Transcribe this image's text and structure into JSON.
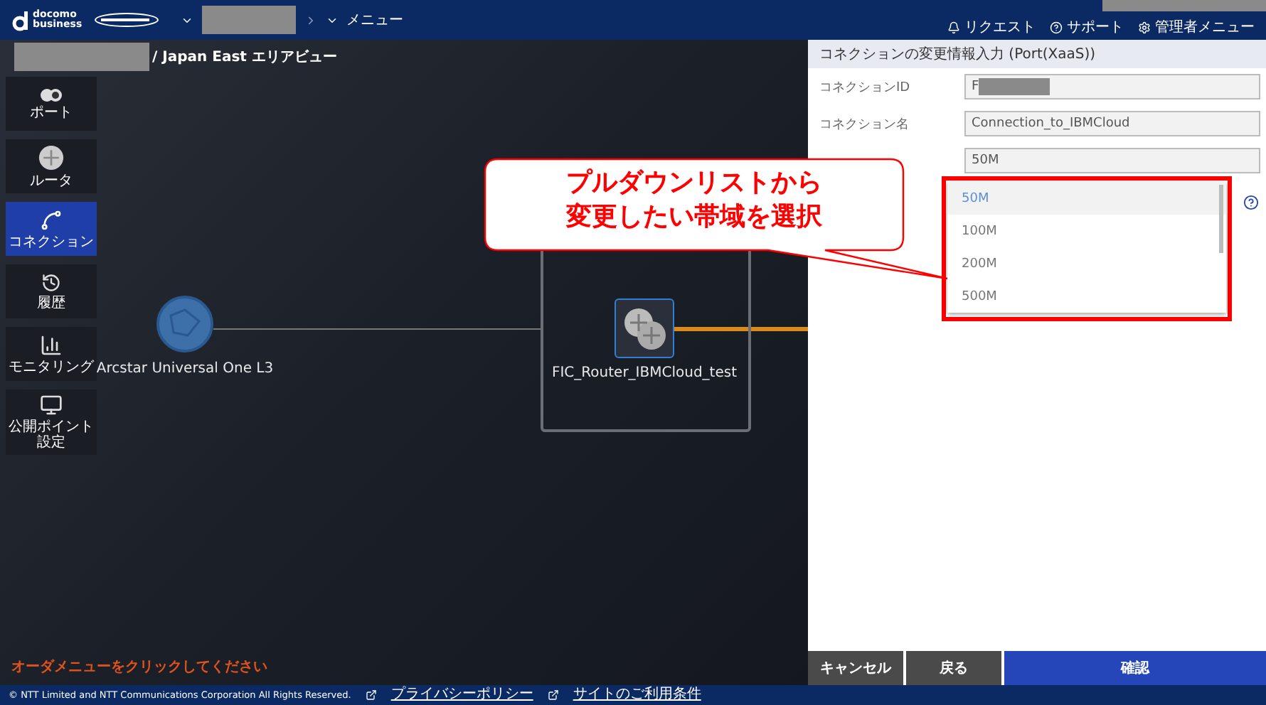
{
  "header": {
    "brand": [
      "docomo",
      "business"
    ],
    "account_redacted": true,
    "breadcrumb": [
      {
        "kind": "redacted"
      },
      {
        "kind": "text",
        "label": "メニュー"
      }
    ],
    "links": [
      {
        "label": "リクエスト"
      },
      {
        "label": "サポート"
      },
      {
        "label": "管理者メニュー"
      }
    ]
  },
  "view_title": {
    "redacted": true,
    "text": "/ Japan East エリアビュー"
  },
  "sidebar": {
    "items": [
      {
        "label": "ポート",
        "selected": false
      },
      {
        "label": "ルータ",
        "selected": false
      },
      {
        "label": "コネクション",
        "selected": true
      },
      {
        "label": "履歴",
        "selected": false
      },
      {
        "label": "モニタリング",
        "selected": false
      },
      {
        "label": "公開ポイント設定",
        "selected": false
      }
    ]
  },
  "canvas": {
    "nodes": [
      {
        "kind": "cloud",
        "label": "Arcstar Universal One L3"
      },
      {
        "kind": "router",
        "label": "FIC_Router_IBMCloud_test"
      }
    ]
  },
  "callout": [
    "プルダウンリストから",
    "変更したい帯域を選択"
  ],
  "hint": "オーダメニューをクリックしてください",
  "panel": {
    "title": "コネクションの変更情報入力 (Port(XaaS))",
    "fields": [
      {
        "label": "コネクションID",
        "value": "F",
        "redacted": true
      },
      {
        "label": "コネクション名",
        "value": "Connection_to_IBMCloud",
        "redacted": false
      },
      {
        "value": "50M",
        "redacted": false
      }
    ],
    "dropdown": {
      "options": [
        {
          "label": "50M",
          "selected": true
        },
        {
          "label": "100M",
          "selected": false
        },
        {
          "label": "200M",
          "selected": false
        },
        {
          "label": "500M",
          "selected": false
        }
      ]
    },
    "buttons": [
      {
        "kind": "dark",
        "label": "キャンセル"
      },
      {
        "kind": "dark",
        "label": "戻る"
      },
      {
        "kind": "primary",
        "label": "確認"
      }
    ]
  },
  "footer": {
    "copyright": "© NTT Limited and NTT Communications Corporation All Rights Reserved.",
    "links": [
      "プライバシーポリシー",
      "サイトのご利用条件"
    ]
  }
}
